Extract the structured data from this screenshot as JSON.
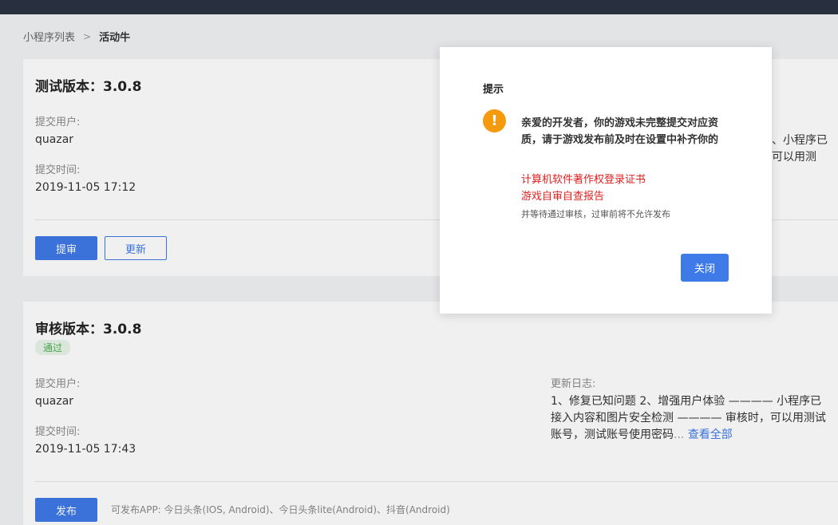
{
  "breadcrumb": {
    "parent": "小程序列表",
    "separator": ">",
    "current": "活动牛"
  },
  "test_version": {
    "title": "测试版本：3.0.8",
    "submit_user_label": "提交用户:",
    "submit_user_value": "quazar",
    "submit_time_label": "提交时间:",
    "submit_time_value": "2019-11-05 17:12",
    "right_snippet": "、小程序已 可以用测",
    "submit_review_button": "提审",
    "update_button": "更新"
  },
  "review_version": {
    "title": "审核版本：3.0.8",
    "status": "通过",
    "submit_user_label": "提交用户:",
    "submit_user_value": "quazar",
    "submit_time_label": "提交时间:",
    "submit_time_value": "2019-11-05 17:43",
    "changelog_label": "更新日志:",
    "changelog_text": "1、修复已知问题 2、增强用户体验 ———— 小程序已接入内容和图片安全检测 ———— 审核时，可以用测试账号，测试账号使用密码",
    "changelog_ellipsis": "...",
    "view_all": "查看全部",
    "publish_button": "发布",
    "publish_apps": "可发布APP: 今日头条(IOS, Android)、今日头条lite(Android)、抖音(Android)"
  },
  "modal": {
    "title": "提示",
    "icon": "warning-icon",
    "icon_glyph": "!",
    "message": "亲爱的开发者，你的游戏未完整提交对应资质，请于游戏发布前及时在设置中补齐你的",
    "requirement_1": "计算机软件著作权登录证书",
    "requirement_2": "游戏自审自查报告",
    "note": "并等待通过审核，过审前将不允许发布",
    "close_button": "关闭"
  },
  "colors": {
    "topbar": "#2b3445",
    "primary": "#3e7ae8",
    "warning": "#f59a0c",
    "danger": "#e02020",
    "success": "#4caf50"
  }
}
